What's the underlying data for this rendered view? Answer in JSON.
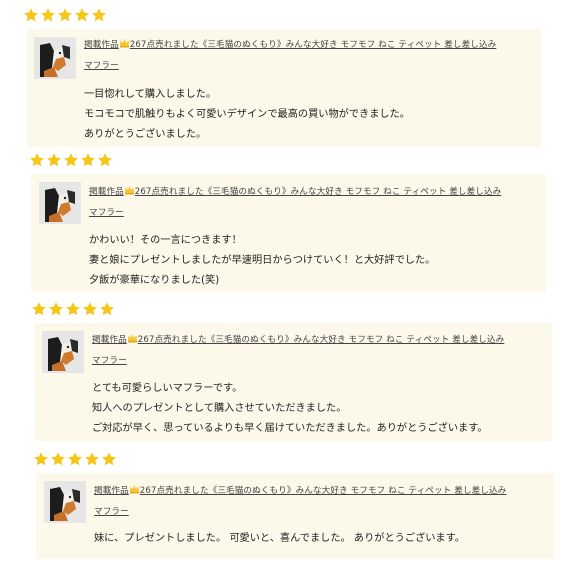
{
  "colors": {
    "star": "#f5c518",
    "card_bg": "#fcf8ea",
    "link": "#444444"
  },
  "reviews": [
    {
      "rating": 5,
      "product_prefix": "掲載作品",
      "product_line1": "267点売れました《三毛猫のぬくもり》みんな大好き モフモフ ねこ ティペット 差し差し込み",
      "product_line2": "マフラー",
      "text": [
        "一目惚れして購入しました。",
        "モコモコで肌触りもよく可愛いデザインで最高の買い物ができました。",
        "ありがとうございました。"
      ]
    },
    {
      "rating": 5,
      "product_prefix": "掲載作品",
      "product_line1": "267点売れました《三毛猫のぬくもり》みんな大好き モフモフ ねこ ティペット 差し差し込み",
      "product_line2": "マフラー",
      "text": [
        "かわいい！その一言につきます！",
        "妻と娘にプレゼントしましたが早速明日からつけていく！と大好評でした。",
        "夕飯が豪華になりました(笑)"
      ]
    },
    {
      "rating": 5,
      "product_prefix": "掲載作品",
      "product_line1": "267点売れました《三毛猫のぬくもり》みんな大好き モフモフ ねこ ティペット 差し差し込み",
      "product_line2": "マフラー",
      "text": [
        "とても可愛らしいマフラーです。",
        "知人へのプレゼントとして購入させていただきました。",
        "ご対応が早く、思っているよりも早く届けていただきました。ありがとうございます。"
      ]
    },
    {
      "rating": 5,
      "product_prefix": "掲載作品",
      "product_line1": "267点売れました《三毛猫のぬくもり》みんな大好き モフモフ ねこ ティペット 差し差し込み",
      "product_line2": "マフラー",
      "text": [
        "妹に、プレゼントしました。 可愛いと、喜んでました。 ありがとうございます。"
      ]
    }
  ]
}
